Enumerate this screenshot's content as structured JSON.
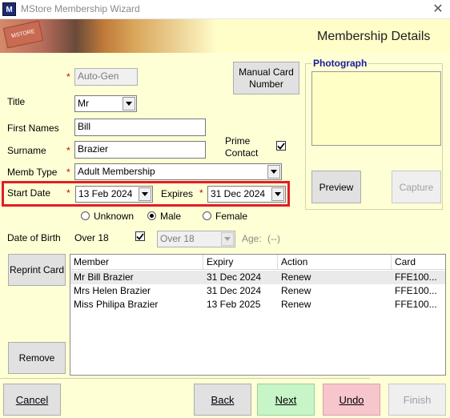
{
  "window": {
    "title": "MStore Membership Wizard",
    "app_icon_text": "M"
  },
  "banner": {
    "title": "Membership Details",
    "card_text": "MSTORE"
  },
  "form": {
    "auto_gen": "Auto-Gen",
    "manual_card_label": "Manual Card Number",
    "title_label": "Title",
    "title_value": "Mr",
    "first_names_label": "First Names",
    "first_names_value": "Bill",
    "surname_label": "Surname",
    "surname_value": "Brazier",
    "prime_contact_label": "Prime Contact",
    "prime_contact_checked": true,
    "memb_type_label": "Memb Type",
    "memb_type_value": "Adult Membership",
    "start_date_label": "Start Date",
    "start_date_value": "13 Feb 2024",
    "expires_label": "Expires",
    "expires_value": "31 Dec 2024",
    "gender_options": [
      "Unknown",
      "Male",
      "Female"
    ],
    "gender_selected": "Male",
    "dob_label": "Date of Birth",
    "over18_label": "Over 18",
    "over18_checked": true,
    "over18_select": "Over 18",
    "age_label": "Age:",
    "age_value": "(--)",
    "required_mark": "*"
  },
  "photo": {
    "legend": "Photograph",
    "preview_label": "Preview",
    "capture_label": "Capture"
  },
  "actions": {
    "reprint_label": "Reprint Card",
    "remove_label": "Remove"
  },
  "table": {
    "columns": [
      "Member",
      "Expiry",
      "Action",
      "Card"
    ],
    "rows": [
      {
        "member": "Mr Bill Brazier",
        "expiry": "31 Dec 2024",
        "action": "Renew",
        "card": "FFE100..."
      },
      {
        "member": "Mrs Helen Brazier",
        "expiry": "31 Dec 2024",
        "action": "Renew",
        "card": "FFE100..."
      },
      {
        "member": "Miss Philipa Brazier",
        "expiry": "13 Feb 2025",
        "action": "Renew",
        "card": "FFE100..."
      }
    ]
  },
  "nav": {
    "cancel": "Cancel",
    "back": "Back",
    "next": "Next",
    "undo": "Undo",
    "finish": "Finish"
  },
  "colors": {
    "background": "#ffffd6",
    "highlight": "#e01e26",
    "next": "#c8f5c8",
    "undo": "#f7c6cc",
    "required": "#d00000"
  }
}
